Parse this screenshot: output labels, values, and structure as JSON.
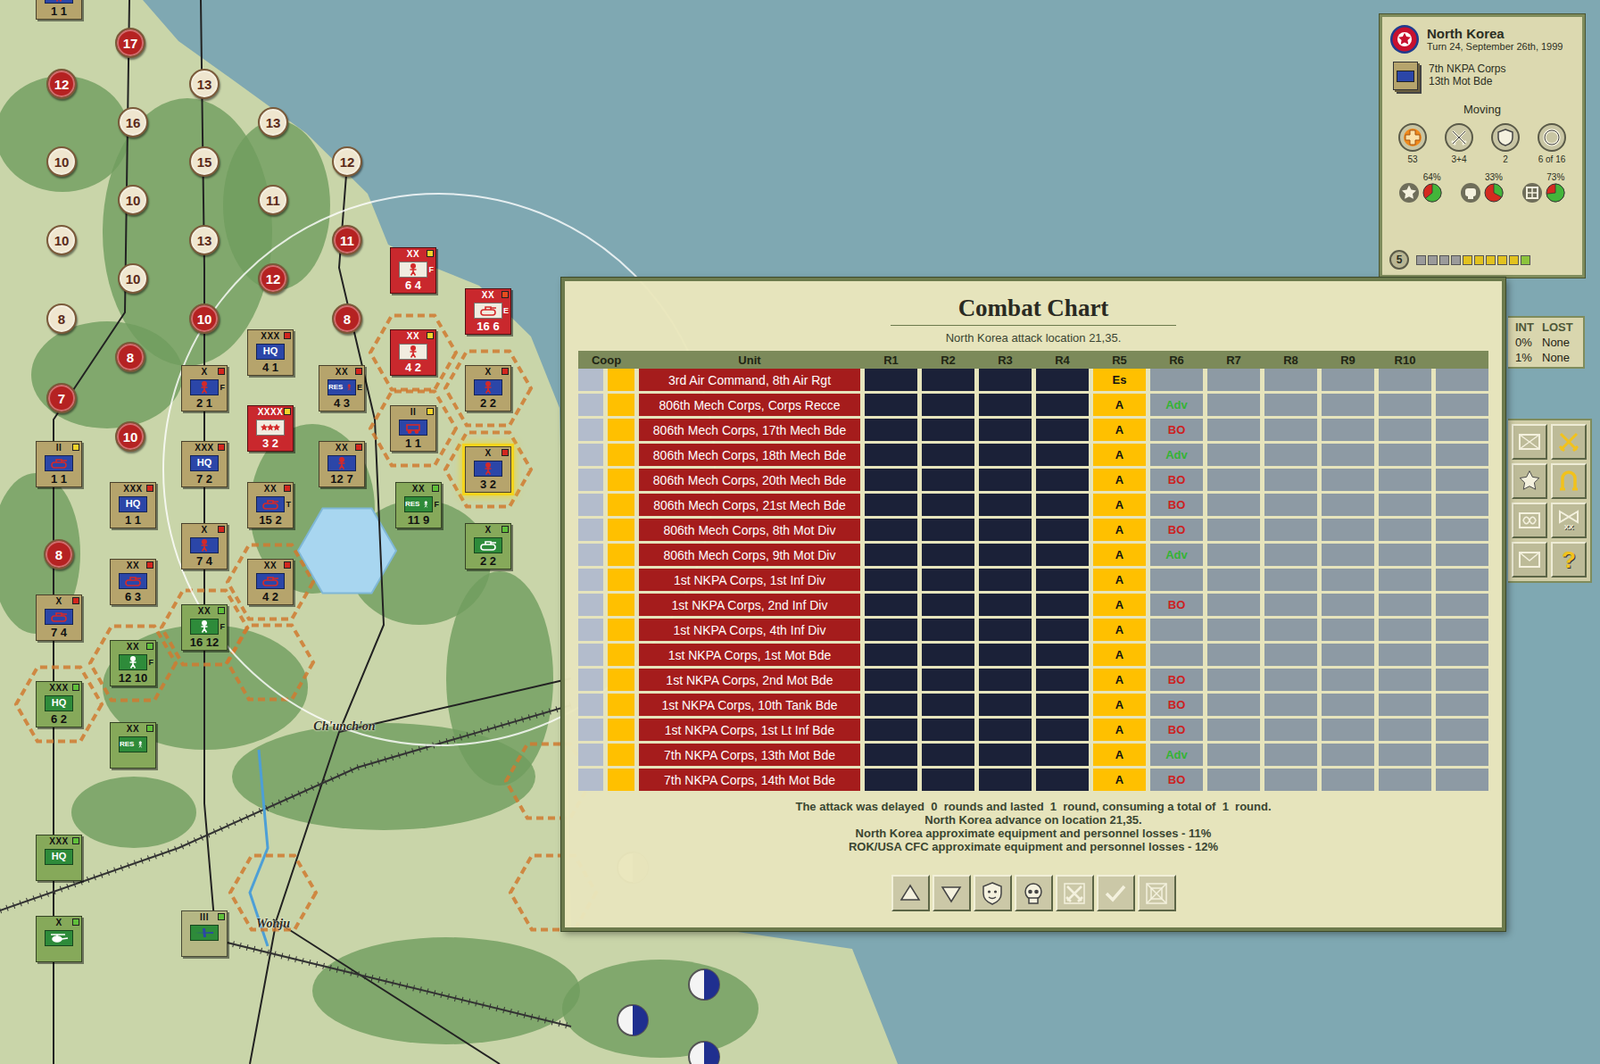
{
  "map": {
    "places": [
      {
        "name": "Ch'unch'on"
      },
      {
        "name": "Wonju"
      }
    ],
    "victory_points": [
      {
        "value": "17",
        "color": "#b52222"
      },
      {
        "value": "12",
        "color": "#b52222"
      },
      {
        "value": "13",
        "color": "#efe6cf"
      },
      {
        "value": "16",
        "color": "#efe6cf"
      },
      {
        "value": "13",
        "color": "#efe6cf"
      },
      {
        "value": "10",
        "color": "#efe6cf"
      },
      {
        "value": "15",
        "color": "#efe6cf"
      },
      {
        "value": "12",
        "color": "#efe6cf"
      },
      {
        "value": "10",
        "color": "#efe6cf"
      },
      {
        "value": "11",
        "color": "#efe6cf"
      },
      {
        "value": "10",
        "color": "#efe6cf"
      },
      {
        "value": "13",
        "color": "#efe6cf"
      },
      {
        "value": "11",
        "color": "#b52222"
      },
      {
        "value": "10",
        "color": "#efe6cf"
      },
      {
        "value": "12",
        "color": "#b52222"
      },
      {
        "value": "8",
        "color": "#efe6cf"
      },
      {
        "value": "10",
        "color": "#b52222"
      },
      {
        "value": "8",
        "color": "#b52222"
      },
      {
        "value": "8",
        "color": "#b52222"
      },
      {
        "value": "7",
        "color": "#b52222"
      },
      {
        "value": "10",
        "color": "#b52222"
      },
      {
        "value": "8",
        "color": "#b52222"
      }
    ],
    "units": [
      {
        "echelon": "XX",
        "kind": "infantry",
        "badge": "",
        "numbers": "6 4",
        "side_letter": "F",
        "color": "#c9282d",
        "status": "#f2d22a",
        "force": "nkpa",
        "selected": false
      },
      {
        "echelon": "XX",
        "kind": "armor",
        "badge": "",
        "numbers": "16 6",
        "side_letter": "E",
        "color": "#c9282d",
        "status": "#e64b1e",
        "force": "nkpa",
        "selected": false
      },
      {
        "echelon": "XX",
        "kind": "infantry",
        "badge": "",
        "numbers": "4 2",
        "side_letter": "",
        "color": "#c9282d",
        "status": "#f2d22a",
        "force": "nkpa",
        "selected": false
      },
      {
        "echelon": "XXXX",
        "kind": "stars",
        "badge": "",
        "numbers": "3 2",
        "side_letter": "",
        "color": "#c9282d",
        "status": "#f2d22a",
        "force": "nkpa",
        "selected": false
      },
      {
        "echelon": "X",
        "kind": "infantry",
        "badge": "",
        "numbers": "2 1",
        "side_letter": "F",
        "color": "#b6a46c",
        "status": "#d2261e",
        "force": "nkpa",
        "selected": false
      },
      {
        "echelon": "XXX",
        "kind": "hq",
        "badge": "HQ",
        "numbers": "4 1",
        "side_letter": "",
        "color": "#b6a46c",
        "status": "#d2261e",
        "force": "nkpa",
        "selected": false
      },
      {
        "echelon": "XX",
        "kind": "res",
        "badge": "RES",
        "numbers": "4 3",
        "side_letter": "E",
        "color": "#b6a46c",
        "status": "#d2261e",
        "force": "nkpa",
        "selected": false
      },
      {
        "echelon": "II",
        "kind": "recon",
        "badge": "",
        "numbers": "1 1",
        "side_letter": "",
        "color": "#b6a46c",
        "status": "#f2d22a",
        "force": "nkpa",
        "selected": false
      },
      {
        "echelon": "X",
        "kind": "infantry",
        "badge": "",
        "numbers": "2 2",
        "side_letter": "",
        "color": "#b6a46c",
        "status": "#d2261e",
        "force": "nkpa",
        "selected": false
      },
      {
        "echelon": "X",
        "kind": "infantry",
        "badge": "",
        "numbers": "3 2",
        "side_letter": "",
        "color": "#b6a46c",
        "status": "#d2261e",
        "force": "nkpa",
        "selected": true
      },
      {
        "echelon": "XX",
        "kind": "infantry",
        "badge": "",
        "numbers": "12 7",
        "side_letter": "",
        "color": "#b6a46c",
        "status": "#d2261e",
        "force": "nkpa",
        "selected": false
      },
      {
        "echelon": "XXX",
        "kind": "hq",
        "badge": "HQ",
        "numbers": "7 2",
        "side_letter": "",
        "color": "#b6a46c",
        "status": "#d2261e",
        "force": "nkpa",
        "selected": false
      },
      {
        "echelon": "XX",
        "kind": "armor",
        "badge": "",
        "numbers": "15 2",
        "side_letter": "T",
        "color": "#b6a46c",
        "status": "#d2261e",
        "force": "nkpa",
        "selected": false
      },
      {
        "echelon": "X",
        "kind": "infantry",
        "badge": "",
        "numbers": "7 4",
        "side_letter": "",
        "color": "#b6a46c",
        "status": "#d2261e",
        "force": "nkpa",
        "selected": false
      },
      {
        "echelon": "XX",
        "kind": "armor",
        "badge": "",
        "numbers": "4 2",
        "side_letter": "",
        "color": "#b6a46c",
        "status": "#d2261e",
        "force": "nkpa",
        "selected": false
      },
      {
        "echelon": "XXX",
        "kind": "hq",
        "badge": "HQ",
        "numbers": "1 1",
        "side_letter": "",
        "color": "#b6a46c",
        "status": "#d2261e",
        "force": "nkpa",
        "selected": false
      },
      {
        "echelon": "II",
        "kind": "armor",
        "badge": "",
        "numbers": "1 1",
        "side_letter": "",
        "color": "#b6a46c",
        "status": "#f2d22a",
        "force": "nkpa",
        "selected": false
      },
      {
        "echelon": "XX",
        "kind": "armor",
        "badge": "",
        "numbers": "6 3",
        "side_letter": "",
        "color": "#b6a46c",
        "status": "#d2261e",
        "force": "nkpa",
        "selected": false
      },
      {
        "echelon": "X",
        "kind": "armor",
        "badge": "",
        "numbers": "7 4",
        "side_letter": "",
        "color": "#b6a46c",
        "status": "#d2261e",
        "force": "nkpa",
        "selected": false
      },
      {
        "echelon": "",
        "kind": "infantry",
        "badge": "",
        "numbers": "1 1",
        "side_letter": "",
        "color": "#b6a46c",
        "status": "#f2d22a",
        "force": "nkpa",
        "selected": false
      },
      {
        "echelon": "XX",
        "kind": "res",
        "badge": "RES",
        "numbers": "11 9",
        "side_letter": "F",
        "color": "#86a95a",
        "status": "#5fbf3a",
        "force": "rok",
        "selected": false
      },
      {
        "echelon": "X",
        "kind": "armor",
        "badge": "",
        "numbers": "2 2",
        "side_letter": "",
        "color": "#86a95a",
        "status": "#5fbf3a",
        "force": "rok",
        "selected": false
      },
      {
        "echelon": "XX",
        "kind": "infantry",
        "badge": "",
        "numbers": "16 12",
        "side_letter": "F",
        "color": "#86a95a",
        "status": "#5fbf3a",
        "force": "rok",
        "selected": false
      },
      {
        "echelon": "XX",
        "kind": "infantry",
        "badge": "",
        "numbers": "12 10",
        "side_letter": "F",
        "color": "#86a95a",
        "status": "#5fbf3a",
        "force": "rok",
        "selected": false
      },
      {
        "echelon": "XXX",
        "kind": "hq",
        "badge": "HQ",
        "numbers": "6 2",
        "side_letter": "",
        "color": "#86a95a",
        "status": "#5fbf3a",
        "force": "rok",
        "selected": false
      },
      {
        "echelon": "XX",
        "kind": "res",
        "badge": "RES",
        "numbers": "",
        "side_letter": "",
        "color": "#86a95a",
        "status": "#5fbf3a",
        "force": "rok",
        "selected": false
      },
      {
        "echelon": "XXX",
        "kind": "hq",
        "badge": "HQ",
        "numbers": "",
        "side_letter": "",
        "color": "#86a95a",
        "status": "#5fbf3a",
        "force": "rok",
        "selected": false
      },
      {
        "echelon": "X",
        "kind": "heli",
        "badge": "",
        "numbers": "",
        "side_letter": "",
        "color": "#86a95a",
        "status": "#5fbf3a",
        "force": "rok",
        "selected": false
      },
      {
        "echelon": "III",
        "kind": "air",
        "badge": "",
        "numbers": "",
        "side_letter": "",
        "color": "#b5b784",
        "status": "#5fbf3a",
        "force": "rok",
        "selected": false
      }
    ]
  },
  "info_panel": {
    "nation": "North Korea",
    "turn": "Turn 24, September 26th, 1999",
    "corps": "7th NKPA Corps",
    "unit": "13th Mot Bde",
    "mode": "Moving",
    "stats": [
      {
        "kind": "medical",
        "label": "53"
      },
      {
        "kind": "attack",
        "label": "3+4"
      },
      {
        "kind": "defense",
        "label": "2"
      },
      {
        "kind": "move",
        "label": "6 of 16"
      }
    ],
    "ratings": [
      {
        "kind": "experience",
        "reading": "64%",
        "level": 0.64
      },
      {
        "kind": "morale",
        "reading": "33%",
        "level": 0.33
      },
      {
        "kind": "supply",
        "reading": "73%",
        "level": 0.73
      }
    ],
    "readiness": {
      "value": "5",
      "squares": [
        {
          "color": "#9b9b9b"
        },
        {
          "color": "#9b9b9b"
        },
        {
          "color": "#9b9b9b"
        },
        {
          "color": "#9b9b9b"
        },
        {
          "color": "#e2c21f"
        },
        {
          "color": "#e2c21f"
        },
        {
          "color": "#e2c21f"
        },
        {
          "color": "#e2c21f"
        },
        {
          "color": "#e2c21f"
        },
        {
          "color": "#8cc43c"
        }
      ]
    }
  },
  "side_table": {
    "columns": [
      "INT",
      "LOST"
    ],
    "rows": [
      [
        "0%",
        "None"
      ],
      [
        "1%",
        "None"
      ]
    ]
  },
  "tool_buttons": [
    {
      "kind": "report",
      "label": ""
    },
    {
      "kind": "attack",
      "label": ""
    },
    {
      "kind": "star",
      "label": ""
    },
    {
      "kind": "retreat",
      "label": ""
    },
    {
      "kind": "stack",
      "label": ""
    },
    {
      "kind": "corps",
      "label": "XX"
    },
    {
      "kind": "mail",
      "label": ""
    },
    {
      "kind": "help",
      "label": "?"
    }
  ],
  "combat_chart": {
    "title": "Combat Chart",
    "subtitle": "North Korea attack location 21,35.",
    "columns": [
      "Coop",
      "Unit",
      "R1",
      "R2",
      "R3",
      "R4",
      "R5",
      "R6",
      "R7",
      "R8",
      "R9",
      "R10"
    ],
    "round_kinds": [
      "done",
      "done",
      "done",
      "done",
      "current",
      "next",
      "empty",
      "empty",
      "empty",
      "empty",
      "empty"
    ],
    "rows": [
      {
        "unit": "3rd Air Command, 8th Air Rgt",
        "cells": [
          "",
          "",
          "",
          "",
          "Es",
          "",
          "",
          "",
          "",
          "",
          ""
        ],
        "outcome_color": "#cc1f1f"
      },
      {
        "unit": "806th Mech Corps, Corps Recce",
        "cells": [
          "",
          "",
          "",
          "",
          "A",
          "Adv",
          "",
          "",
          "",
          "",
          ""
        ],
        "outcome_color": "#35b335"
      },
      {
        "unit": "806th Mech Corps, 17th Mech Bde",
        "cells": [
          "",
          "",
          "",
          "",
          "A",
          "BO",
          "",
          "",
          "",
          "",
          ""
        ],
        "outcome_color": "#cc1f1f"
      },
      {
        "unit": "806th Mech Corps, 18th Mech Bde",
        "cells": [
          "",
          "",
          "",
          "",
          "A",
          "Adv",
          "",
          "",
          "",
          "",
          ""
        ],
        "outcome_color": "#35b335"
      },
      {
        "unit": "806th Mech Corps, 20th Mech Bde",
        "cells": [
          "",
          "",
          "",
          "",
          "A",
          "BO",
          "",
          "",
          "",
          "",
          ""
        ],
        "outcome_color": "#cc1f1f"
      },
      {
        "unit": "806th Mech Corps, 21st Mech Bde",
        "cells": [
          "",
          "",
          "",
          "",
          "A",
          "BO",
          "",
          "",
          "",
          "",
          ""
        ],
        "outcome_color": "#cc1f1f"
      },
      {
        "unit": "806th Mech Corps, 8th Mot Div",
        "cells": [
          "",
          "",
          "",
          "",
          "A",
          "BO",
          "",
          "",
          "",
          "",
          ""
        ],
        "outcome_color": "#cc1f1f"
      },
      {
        "unit": "806th Mech Corps, 9th Mot Div",
        "cells": [
          "",
          "",
          "",
          "",
          "A",
          "Adv",
          "",
          "",
          "",
          "",
          ""
        ],
        "outcome_color": "#35b335"
      },
      {
        "unit": "1st NKPA Corps, 1st Inf Div",
        "cells": [
          "",
          "",
          "",
          "",
          "A",
          "",
          "",
          "",
          "",
          "",
          ""
        ],
        "outcome_color": "#cc1f1f"
      },
      {
        "unit": "1st NKPA Corps, 2nd Inf Div",
        "cells": [
          "",
          "",
          "",
          "",
          "A",
          "BO",
          "",
          "",
          "",
          "",
          ""
        ],
        "outcome_color": "#cc1f1f"
      },
      {
        "unit": "1st NKPA Corps, 4th Inf Div",
        "cells": [
          "",
          "",
          "",
          "",
          "A",
          "",
          "",
          "",
          "",
          "",
          ""
        ],
        "outcome_color": "#cc1f1f"
      },
      {
        "unit": "1st NKPA Corps, 1st Mot Bde",
        "cells": [
          "",
          "",
          "",
          "",
          "A",
          "",
          "",
          "",
          "",
          "",
          ""
        ],
        "outcome_color": "#cc1f1f"
      },
      {
        "unit": "1st NKPA Corps, 2nd Mot Bde",
        "cells": [
          "",
          "",
          "",
          "",
          "A",
          "BO",
          "",
          "",
          "",
          "",
          ""
        ],
        "outcome_color": "#cc1f1f"
      },
      {
        "unit": "1st NKPA Corps, 10th Tank Bde",
        "cells": [
          "",
          "",
          "",
          "",
          "A",
          "BO",
          "",
          "",
          "",
          "",
          ""
        ],
        "outcome_color": "#cc1f1f"
      },
      {
        "unit": "1st NKPA Corps, 1st Lt Inf Bde",
        "cells": [
          "",
          "",
          "",
          "",
          "A",
          "BO",
          "",
          "",
          "",
          "",
          ""
        ],
        "outcome_color": "#cc1f1f"
      },
      {
        "unit": "7th NKPA Corps, 13th Mot Bde",
        "cells": [
          "",
          "",
          "",
          "",
          "A",
          "Adv",
          "",
          "",
          "",
          "",
          ""
        ],
        "outcome_color": "#35b335"
      },
      {
        "unit": "7th NKPA Corps, 14th Mot Bde",
        "cells": [
          "",
          "",
          "",
          "",
          "A",
          "BO",
          "",
          "",
          "",
          "",
          ""
        ],
        "outcome_color": "#cc1f1f"
      }
    ],
    "footer": [
      "The attack was delayed  0  rounds and lasted  1  round, consuming a total of  1  round.",
      "North Korea advance on location 21,35.",
      "North Korea approximate equipment and personnel losses - 11%",
      "ROK/USA CFC approximate equipment and personnel losses - 12%"
    ]
  }
}
